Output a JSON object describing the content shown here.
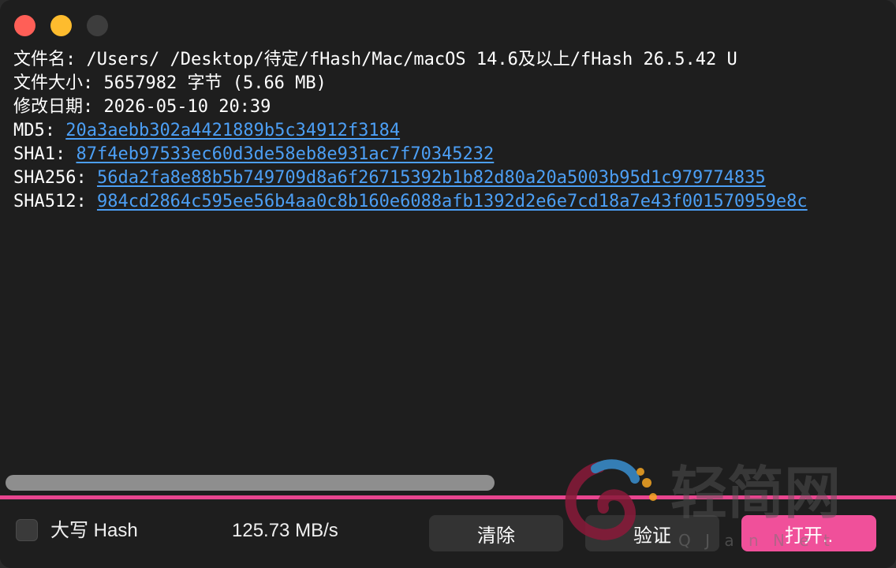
{
  "window": {
    "controls": {
      "close_color": "#ff5f57",
      "minimize_color": "#febc2e",
      "maximize_color": "#3d3d3d"
    }
  },
  "output": {
    "filename_label": "文件名:",
    "filename_value": "/Users/        /Desktop/待定/fHash/Mac/macOS 14.6及以上/fHash 26.5.42 U",
    "size_label": "文件大小:",
    "size_value": "5657982 字节 (5.66 MB)",
    "modified_label": "修改日期:",
    "modified_value": "2026-05-10 20:39",
    "md5_label": "MD5:",
    "md5_value": "20a3aebb302a4421889b5c34912f3184",
    "sha1_label": "SHA1:",
    "sha1_value": "87f4eb97533ec60d3de58eb8e931ac7f70345232",
    "sha256_label": "SHA256:",
    "sha256_value": "56da2fa8e88b5b749709d8a6f26715392b1b82d80a20a5003b95d1c979774835",
    "sha512_label": "SHA512:",
    "sha512_value": "984cd2864c595ee56b4aa0c8b160e6088afb1392d2e6e7cd18a7e43f001570959e8c"
  },
  "progress": {
    "fraction": 1.0,
    "color": "#e8458f"
  },
  "bottom": {
    "uppercase_label": "大写 Hash",
    "uppercase_checked": false,
    "speed": "125.73 MB/s",
    "clear_label": "清除",
    "verify_label": "验证",
    "open_label": "打开.."
  },
  "watermark": {
    "text": "轻简网",
    "subtext": "Q J a n N e t"
  },
  "colors": {
    "accent": "#f0509a",
    "link": "#4c9ff5",
    "background": "#1e1e1e"
  }
}
